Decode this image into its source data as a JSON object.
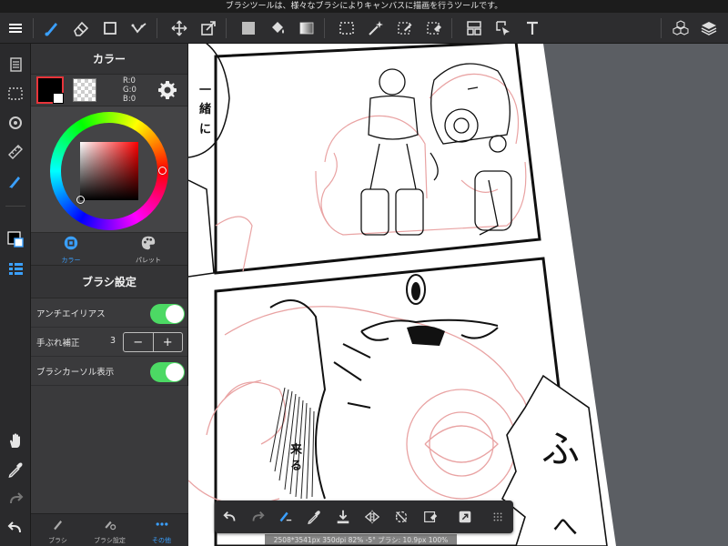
{
  "hint": "ブラシツールは、様々なブラシによりキャンバスに描画を行うツールです。",
  "color_panel": {
    "title": "カラー",
    "r": "R:0",
    "g": "G:0",
    "b": "B:0",
    "current_color": "#000000",
    "tabs": [
      {
        "label": "カラー",
        "icon": "color-circle-icon",
        "active": true
      },
      {
        "label": "パレット",
        "icon": "palette-icon",
        "active": false
      }
    ]
  },
  "brush_settings": {
    "title": "ブラシ設定",
    "antialias_label": "アンチエイリアス",
    "antialias_on": true,
    "stabilizer_label": "手ぶれ補正",
    "stabilizer_value": "3",
    "minus": "−",
    "plus": "+",
    "cursor_label": "ブラシカーソル表示",
    "cursor_on": true
  },
  "bottom_tabs": [
    {
      "label": "ブラシ",
      "icon": "brush-icon",
      "active": false
    },
    {
      "label": "ブラシ設定",
      "icon": "brush-settings-icon",
      "active": false
    },
    {
      "label": "その他",
      "icon": "more-dots-icon",
      "active": true
    }
  ],
  "canvas_text": {
    "speech_1": "一",
    "speech_2": "緒",
    "speech_3": "に",
    "sfx_1": "来",
    "sfx_2": "る",
    "sfx_big_1": "ふ",
    "sfx_big_2": "へ"
  },
  "status": "2508*3541px 350dpi 82% -5° ブラシ: 10.9px 100%",
  "colors": {
    "accent": "#3aa0ff",
    "toggle_on": "#4cd964",
    "toolbar_bg": "#2d2d2f",
    "panel_bg": "#3a3a3c",
    "canvas_bg": "#5b5e63",
    "sketch_red": "#e9a3a3"
  }
}
